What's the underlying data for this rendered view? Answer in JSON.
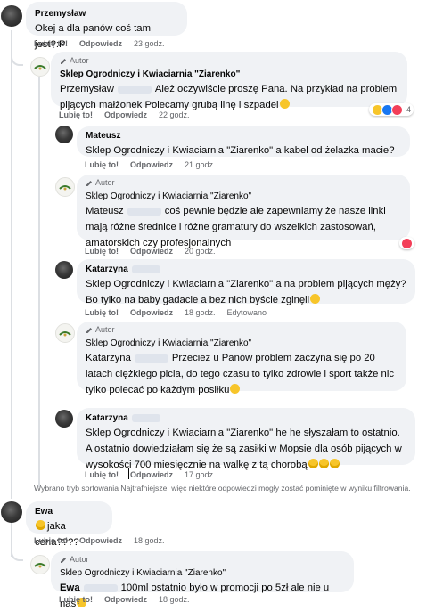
{
  "autor_label": "Autor",
  "like_label": "Lubię to!",
  "reply_label": "Odpowiedz",
  "edited_label": "Edytowano",
  "comments": [
    {
      "id": "c1",
      "author": "Przemysław",
      "text": "Okej a dla panów coś tam jest?:P",
      "time": "23 godz."
    },
    {
      "id": "r1",
      "author": "Sklep Ogrodniczy i Kwiaciarnia \"Ziarenko\"",
      "mention": "Przemysław",
      "text": "Ależ oczywiście proszę Pana. Na przykład na problem pijących małżonek Polecamy grubą linę i szpadel",
      "time": "22 godz.",
      "reactions_count": "4"
    },
    {
      "id": "c2",
      "author": "Mateusz",
      "mention": "Sklep Ogrodniczy i Kwiaciarnia \"Ziarenko\"",
      "text": "a kabel od żelazka macie?",
      "time": "21 godz."
    },
    {
      "id": "r2",
      "author": "Sklep Ogrodniczy i Kwiaciarnia \"Ziarenko\"",
      "mention": "Mateusz",
      "text": "coś pewnie będzie ale zapewniamy że nasze linki mają różne średnice i różne gramatury do wszelkich zastosowań, amatorskich czy profesjonalnych",
      "time": "20 godz."
    },
    {
      "id": "c3",
      "author": "Katarzyna",
      "mention": "Sklep Ogrodniczy i Kwiaciarnia \"Ziarenko\"",
      "text": "a na problem pijących męży? Bo tylko na baby gadacie a bez nich byście zginęli",
      "time": "18 godz."
    },
    {
      "id": "r3",
      "author": "Sklep Ogrodniczy i Kwiaciarnia \"Ziarenko\"",
      "mention": "Katarzyna",
      "text": "Przecież u Panów problem zaczyna się po 20 latach ciężkiego picia, do tego czasu to tylko zdrowie i sport także nic tylko polecać po każdym posiłku",
      "time": "18 godz."
    },
    {
      "id": "c4",
      "author": "Katarzyna",
      "mention": "Sklep Ogrodniczy i Kwiaciarnia \"Ziarenko\"",
      "text": "he he słyszałam to ostatnio. A ostatnio dowiedziałam się że są zasiłki w Mopsie dla osób pijących w wysokości 700 miesięcznie na walkę z tą chorobą",
      "time": "17 godz."
    },
    {
      "id": "c5",
      "author": "Ewa",
      "text": "jaka cena????",
      "time": "18 godz."
    },
    {
      "id": "r5",
      "author": "Sklep Ogrodniczy i Kwiaciarnia \"Ziarenko\"",
      "mention": "Ewa",
      "text": "100ml ostatnio było w promocji po 5zł ale nie u nas",
      "time": "18 godz."
    }
  ],
  "filter_notice": "Wybrano tryb sortowania Najtrafniejsze, więc niektóre odpowiedzi mogły zostać pominięte w wyniku filtrowania.",
  "colors": {
    "bubble": "#f0f2f5",
    "meta": "#65676b",
    "text": "#050505",
    "thread": "#dcdfe3"
  }
}
